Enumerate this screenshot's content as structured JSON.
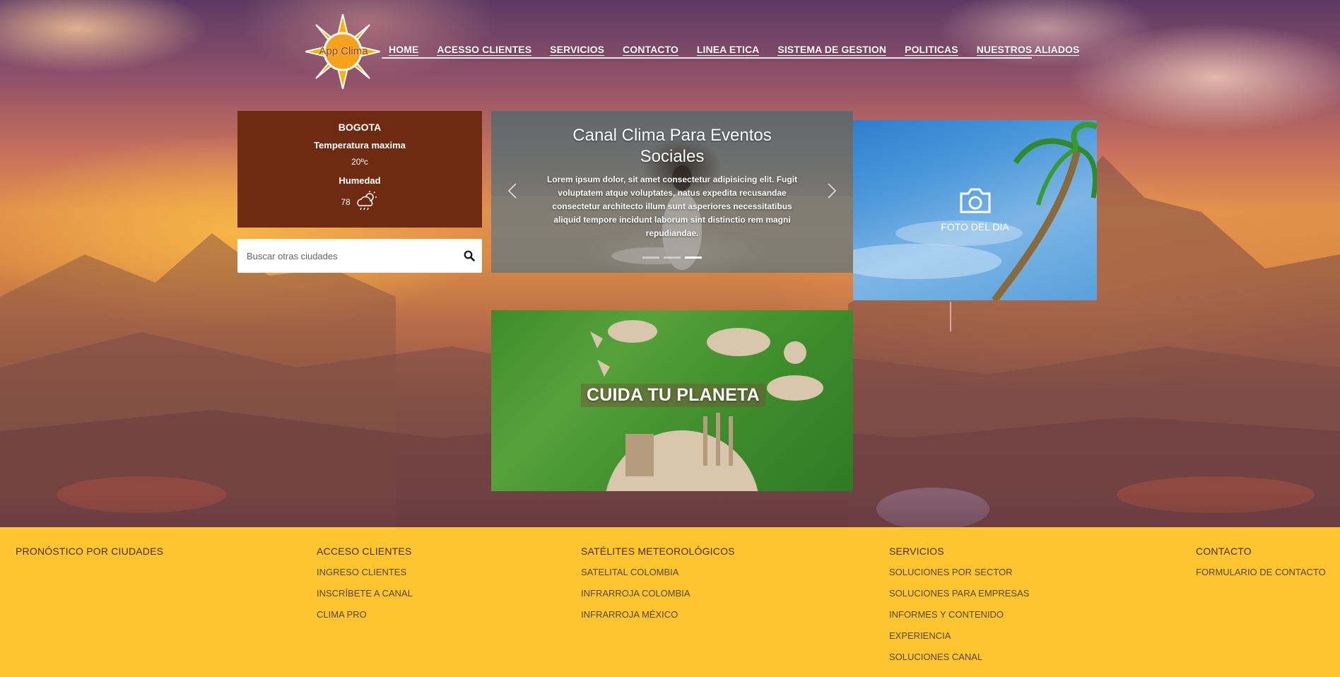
{
  "logo": {
    "text": "App Clima"
  },
  "nav": {
    "items": [
      "HOME",
      "ACESSO CLIENTES",
      "SERVICIOS",
      "CONTACTO",
      "LINEA ETICA",
      "SISTEMA DE GESTION",
      "POLITICAS",
      "NUESTROS ALIADOS"
    ]
  },
  "weather": {
    "city": "BOGOTA",
    "max_temp_label": "Temperatura maxima",
    "max_temp_value": "20ºc",
    "humidity_label": "Humedad",
    "humidity_value": "78",
    "icon": "cloud-sun-rain-icon",
    "bg_color": "#6e2b12"
  },
  "search": {
    "placeholder": "Buscar otras ciudades",
    "value": "",
    "icon": "search-icon"
  },
  "carousel": {
    "title": "Canal Clima Para Eventos Sociales",
    "text": "Lorem ipsum dolor, sit amet consectetur adipisicing elit. Fugit voluptatem atque voluptates, natus expedita recusandae consectetur architecto illum sunt asperiores necessitatibus aliquid tempore incidunt laborum sint distinctio rem magni repudiandae.",
    "slide_count": 3,
    "active_slide": 3,
    "prev_icon": "chevron-left-icon",
    "next_icon": "chevron-right-icon"
  },
  "photo_of_day": {
    "label": "FOTO DEL DIA",
    "icon": "camera-icon"
  },
  "planet_banner": {
    "title": "CUIDA TU PLANETA"
  },
  "footer": {
    "bg_color": "#fdc52f",
    "columns": [
      {
        "heading": "PRONÓSTICO POR CIUDADES",
        "links": []
      },
      {
        "heading": "ACCESO CLIENTES",
        "links": [
          "INGRESO CLIENTES",
          "INSCRÍBETE A CANAL",
          "CLIMA PRO"
        ]
      },
      {
        "heading": "SATÉLITES METEOROLÓGICOS",
        "links": [
          "SATELITAL COLOMBIA",
          "INFRARROJA COLOMBIA",
          "INFRARROJA MÉXICO"
        ]
      },
      {
        "heading": "SERVICIOS",
        "links": [
          "SOLUCIONES POR SECTOR",
          "SOLUCIONES PARA EMPRESAS",
          "INFORMES Y CONTENIDO",
          "EXPERIENCIA",
          "SOLUCIONES CANAL"
        ]
      },
      {
        "heading": "CONTACTO",
        "links": [
          "FORMULARIO DE CONTACTO"
        ]
      }
    ]
  }
}
